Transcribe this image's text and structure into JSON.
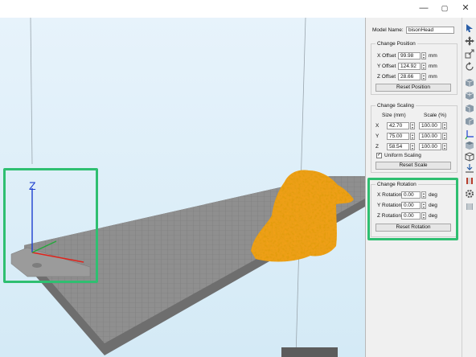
{
  "window": {
    "minimize": "—",
    "maximize": "▢",
    "close": "✕"
  },
  "viewport": {
    "axis_label": "Z",
    "model_color": "#f7a21b",
    "highlight_color": "#2fbf71"
  },
  "panel": {
    "model_name_label": "Model Name:",
    "model_name_value": "bisonHead",
    "position": {
      "title": "Change Position",
      "x_label": "X Offset",
      "x_value": "99.98",
      "y_label": "Y Offset",
      "y_value": "124.92",
      "z_label": "Z Offset",
      "z_value": "28.66",
      "unit": "mm",
      "reset_label": "Reset Position"
    },
    "scaling": {
      "title": "Change Scaling",
      "size_header": "Size (mm)",
      "scale_header": "Scale (%)",
      "rows": [
        {
          "axis": "X",
          "size": "42.70",
          "scale": "100.00"
        },
        {
          "axis": "Y",
          "size": "75.00",
          "scale": "100.00"
        },
        {
          "axis": "Z",
          "size": "58.54",
          "scale": "100.00"
        }
      ],
      "uniform_label": "Uniform Scaling",
      "uniform_checked": "✓",
      "reset_label": "Reset Scale"
    },
    "rotation": {
      "title": "Change Rotation",
      "x_label": "X Rotation",
      "x_value": "0.00",
      "y_label": "Y Rotation",
      "y_value": "0.00",
      "z_label": "Z Rotation",
      "z_value": "0.00",
      "unit": "deg",
      "reset_label": "Reset Rotation"
    }
  },
  "toolbar": {
    "icons": [
      "select-icon",
      "move-icon",
      "scale-icon",
      "rotate-icon",
      "view-front-icon",
      "view-back-icon",
      "view-left-icon",
      "view-right-icon",
      "axis-view-icon",
      "view-top-icon",
      "iso-view-icon",
      "place-on-bed-icon",
      "cube-icon",
      "settings-icon",
      "info-icon"
    ]
  }
}
